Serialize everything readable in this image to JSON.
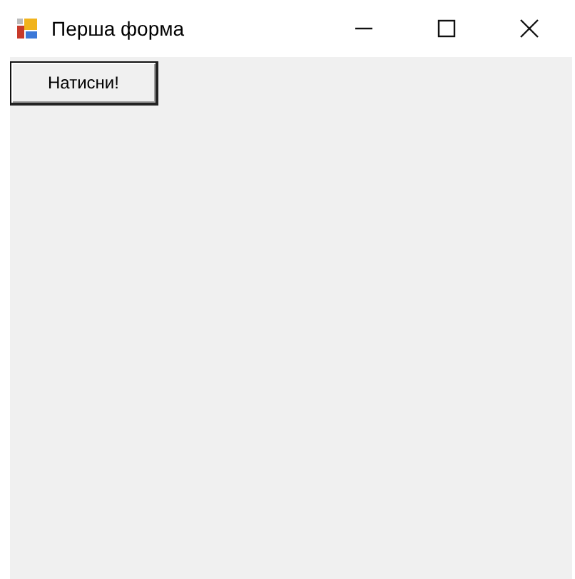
{
  "window": {
    "title": "Перша форма"
  },
  "buttons": [
    {
      "label": "Натисни!"
    }
  ]
}
